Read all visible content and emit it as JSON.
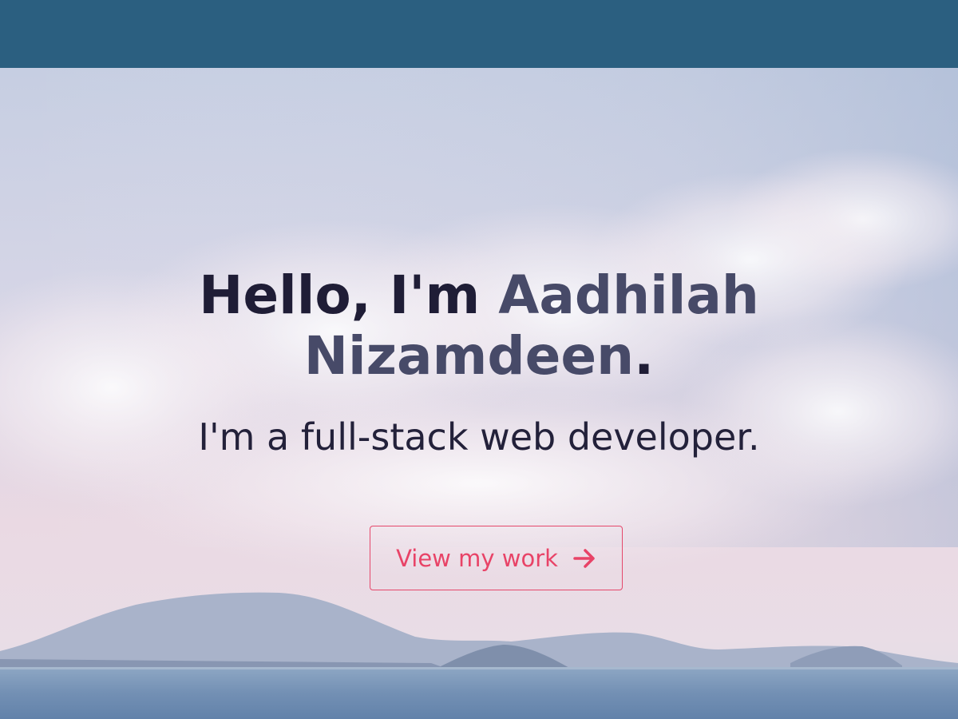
{
  "hero": {
    "greeting": "Hello, I'm ",
    "name": "Aadhilah Nizamdeen",
    "period": ".",
    "tagline": "I'm a full-stack web developer.",
    "cta_label": "View my work",
    "cta_icon": "arrow-right-icon"
  },
  "colors": {
    "navbar": "#2b5f80",
    "headline": "#1f1d36",
    "name_highlight": "#474a68",
    "accent": "#e84367"
  }
}
